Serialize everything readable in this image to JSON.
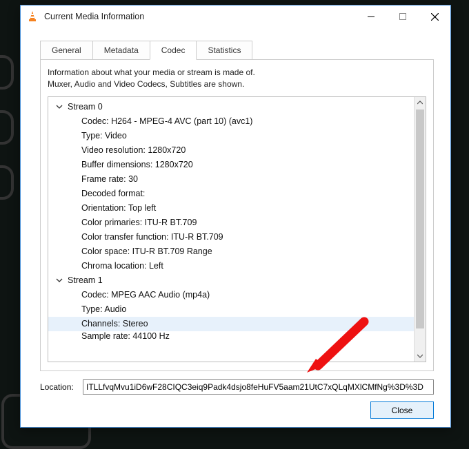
{
  "window": {
    "title": "Current Media Information"
  },
  "tabs": {
    "general": "General",
    "metadata": "Metadata",
    "codec": "Codec",
    "statistics": "Statistics"
  },
  "description": {
    "line1": "Information about what your media or stream is made of.",
    "line2": "Muxer, Audio and Video Codecs, Subtitles are shown."
  },
  "tree": {
    "stream0": {
      "label": "Stream 0",
      "codec": "Codec: H264 - MPEG-4 AVC (part 10) (avc1)",
      "type": "Type: Video",
      "res": "Video resolution: 1280x720",
      "buf": "Buffer dimensions: 1280x720",
      "fps": "Frame rate: 30",
      "dec": "Decoded format:",
      "orient": "Orientation: Top left",
      "prim": "Color primaries: ITU-R BT.709",
      "trans": "Color transfer function: ITU-R BT.709",
      "space": "Color space: ITU-R BT.709 Range",
      "chroma": "Chroma location: Left"
    },
    "stream1": {
      "label": "Stream 1",
      "codec": "Codec: MPEG AAC Audio (mp4a)",
      "type": "Type: Audio",
      "channels": "Channels: Stereo",
      "rate": "Sample rate: 44100 Hz"
    }
  },
  "location": {
    "label": "Location:",
    "value": "ITLLfvqMvu1iD6wF28CIQC3eiq9Padk4dsjo8feHuFV5aam21UtC7xQLqMXlCMfNg%3D%3D"
  },
  "buttons": {
    "close": "Close"
  }
}
